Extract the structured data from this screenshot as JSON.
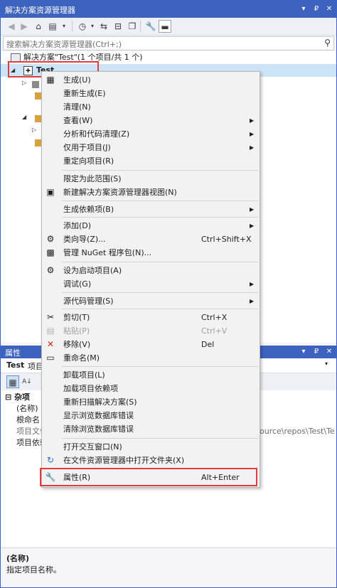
{
  "window": {
    "title": "解决方案资源管理器",
    "controls": [
      "▾",
      "₽",
      "✕"
    ]
  },
  "search": {
    "placeholder": "搜索解决方案资源管理器(Ctrl+;)"
  },
  "tree": {
    "solution_label": "解决方案\"Test\"(1 个项目/共 1 个)",
    "project_label": "Test"
  },
  "properties": {
    "title": "属性",
    "object_name": "Test",
    "object_type": "项目",
    "category": "杂项",
    "rows": [
      "(名称)",
      "根命名",
      "项目文件",
      "项目依赖"
    ],
    "path_fragment": "ource\\repos\\Test\\Test",
    "desc_title": "(名称)",
    "desc_text": "指定项目名称。"
  },
  "menu": {
    "items": [
      {
        "label": "生成(U)",
        "icon": "build-icon",
        "shortcut": "",
        "submenu": false,
        "disabled": false
      },
      {
        "label": "重新生成(E)",
        "icon": "",
        "shortcut": "",
        "submenu": false,
        "disabled": false
      },
      {
        "label": "清理(N)",
        "icon": "",
        "shortcut": "",
        "submenu": false,
        "disabled": false
      },
      {
        "label": "查看(W)",
        "icon": "",
        "shortcut": "",
        "submenu": true,
        "disabled": false
      },
      {
        "label": "分析和代码清理(Z)",
        "icon": "",
        "shortcut": "",
        "submenu": true,
        "disabled": false
      },
      {
        "label": "仅用于项目(J)",
        "icon": "",
        "shortcut": "",
        "submenu": true,
        "disabled": false
      },
      {
        "label": "重定向项目(R)",
        "icon": "",
        "shortcut": "",
        "submenu": false,
        "disabled": false
      },
      {
        "label": "限定为此范围(S)",
        "icon": "",
        "shortcut": "",
        "submenu": false,
        "disabled": false
      },
      {
        "label": "新建解决方案资源管理器视图(N)",
        "icon": "new-view-icon",
        "shortcut": "",
        "submenu": false,
        "disabled": false
      },
      {
        "label": "生成依赖项(B)",
        "icon": "",
        "shortcut": "",
        "submenu": true,
        "disabled": false
      },
      {
        "label": "添加(D)",
        "icon": "",
        "shortcut": "",
        "submenu": true,
        "disabled": false
      },
      {
        "label": "类向导(Z)...",
        "icon": "class-wizard-icon",
        "shortcut": "Ctrl+Shift+X",
        "submenu": false,
        "disabled": false
      },
      {
        "label": "管理 NuGet 程序包(N)...",
        "icon": "nuget-icon",
        "shortcut": "",
        "submenu": false,
        "disabled": false
      },
      {
        "label": "设为启动项目(A)",
        "icon": "gear-icon",
        "shortcut": "",
        "submenu": false,
        "disabled": false
      },
      {
        "label": "调试(G)",
        "icon": "",
        "shortcut": "",
        "submenu": true,
        "disabled": false
      },
      {
        "label": "源代码管理(S)",
        "icon": "",
        "shortcut": "",
        "submenu": true,
        "disabled": false
      },
      {
        "label": "剪切(T)",
        "icon": "scissors-icon",
        "shortcut": "Ctrl+X",
        "submenu": false,
        "disabled": false
      },
      {
        "label": "粘贴(P)",
        "icon": "paste-icon",
        "shortcut": "Ctrl+V",
        "submenu": false,
        "disabled": true
      },
      {
        "label": "移除(V)",
        "icon": "remove-icon",
        "shortcut": "Del",
        "submenu": false,
        "disabled": false
      },
      {
        "label": "重命名(M)",
        "icon": "rename-icon",
        "shortcut": "",
        "submenu": false,
        "disabled": false
      },
      {
        "label": "卸载项目(L)",
        "icon": "",
        "shortcut": "",
        "submenu": false,
        "disabled": false
      },
      {
        "label": "加载项目依赖项",
        "icon": "",
        "shortcut": "",
        "submenu": false,
        "disabled": false
      },
      {
        "label": "重新扫描解决方案(S)",
        "icon": "",
        "shortcut": "",
        "submenu": false,
        "disabled": false
      },
      {
        "label": "显示浏览数据库错误",
        "icon": "",
        "shortcut": "",
        "submenu": false,
        "disabled": false
      },
      {
        "label": "清除浏览数据库错误",
        "icon": "",
        "shortcut": "",
        "submenu": false,
        "disabled": false
      },
      {
        "label": "打开交互窗口(N)",
        "icon": "",
        "shortcut": "",
        "submenu": false,
        "disabled": false
      },
      {
        "label": "在文件资源管理器中打开文件夹(X)",
        "icon": "refresh-arrow-icon",
        "shortcut": "",
        "submenu": false,
        "disabled": false
      },
      {
        "label": "属性(R)",
        "icon": "wrench-icon",
        "shortcut": "Alt+Enter",
        "submenu": false,
        "disabled": false
      }
    ]
  }
}
